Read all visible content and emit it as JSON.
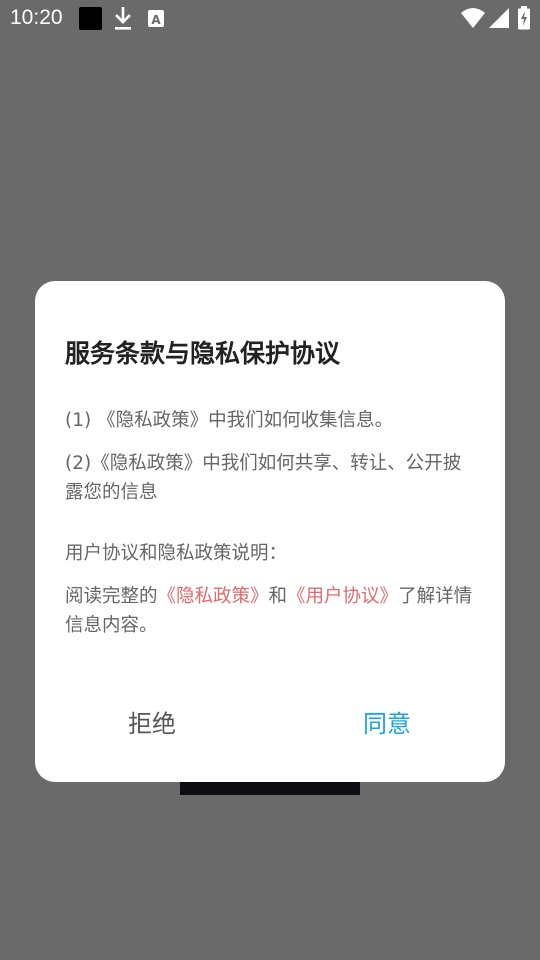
{
  "status_bar": {
    "time": "10:20",
    "a_glyph": "A",
    "icons": [
      "notification-square-icon",
      "download-icon",
      "a-text-icon",
      "wifi-icon",
      "cell-signal-icon",
      "battery-charging-icon"
    ]
  },
  "dialog": {
    "title": "服务条款与隐私保护协议",
    "item1": "(1) 《隐私政策》中我们如何收集信息。",
    "item2": "(2)《隐私政策》中我们如何共享、转让、公开披露您的信息",
    "section_label": "用户协议和隐私政策说明：",
    "read_prefix": "阅读完整的",
    "privacy_link": "《隐私政策》",
    "and_text": "和",
    "user_agreement_link": "《用户协议》",
    "read_suffix": "了解详情信息内容。",
    "reject_label": "拒绝",
    "agree_label": "同意"
  },
  "colors": {
    "overlay_background": "#6a6a6a",
    "dialog_background": "#ffffff",
    "title_text": "#222222",
    "body_text": "#666666",
    "link_text": "#e26a6f",
    "agree_text": "#1aa4de",
    "reject_text": "#555555"
  }
}
